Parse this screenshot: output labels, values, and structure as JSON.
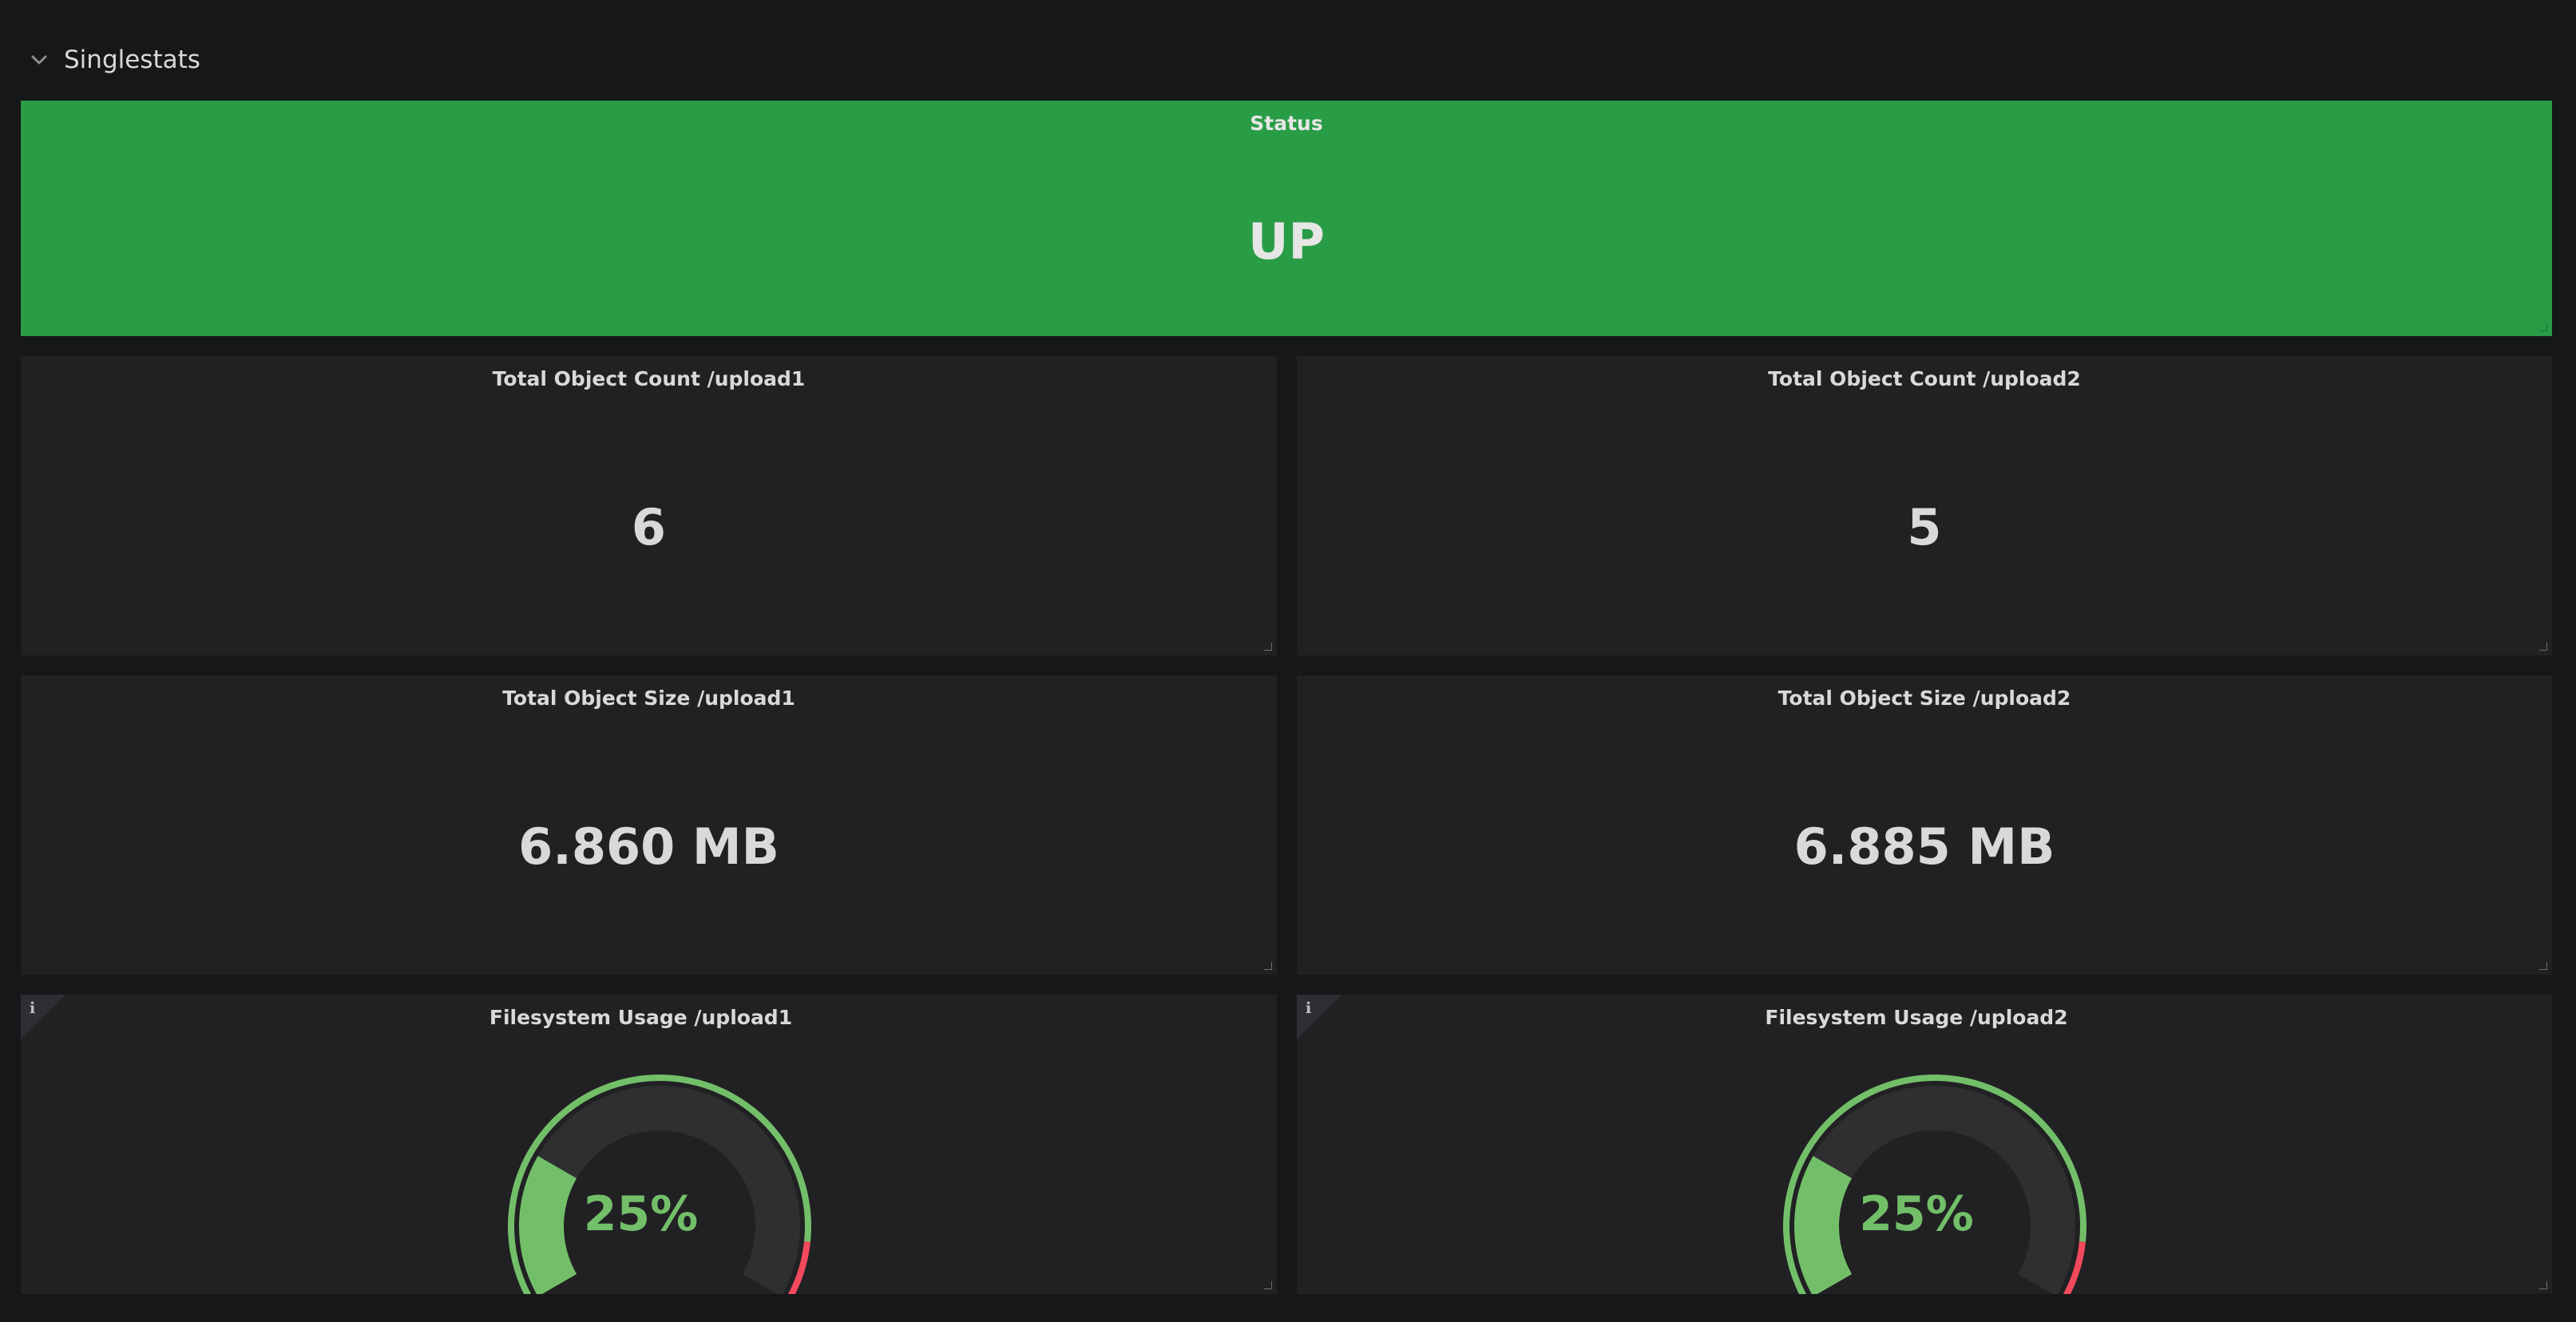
{
  "row": {
    "title": "Singlestats",
    "collapse_icon": "chevron-down-icon"
  },
  "panels": {
    "status": {
      "title": "Status",
      "value": "UP",
      "background": "#299c46"
    },
    "count_upload1": {
      "title": "Total Object Count /upload1",
      "value": "6"
    },
    "count_upload2": {
      "title": "Total Object Count /upload2",
      "value": "5"
    },
    "size_upload1": {
      "title": "Total Object Size /upload1",
      "value": "6.860 MB"
    },
    "size_upload2": {
      "title": "Total Object Size /upload2",
      "value": "6.885 MB"
    },
    "fs_upload1": {
      "title": "Filesystem Usage /upload1",
      "value": "25%",
      "percent": 25,
      "info_icon": "info-icon"
    },
    "fs_upload2": {
      "title": "Filesystem Usage /upload2",
      "value": "25%",
      "percent": 25,
      "info_icon": "info-icon"
    }
  },
  "colors": {
    "ok": "#73bf69",
    "critical": "#f2495c",
    "panel_bg": "#212124",
    "page_bg": "#161719",
    "text": "#d8d9da"
  },
  "gauge": {
    "min": 0,
    "max": 100,
    "threshold_red": 90
  }
}
